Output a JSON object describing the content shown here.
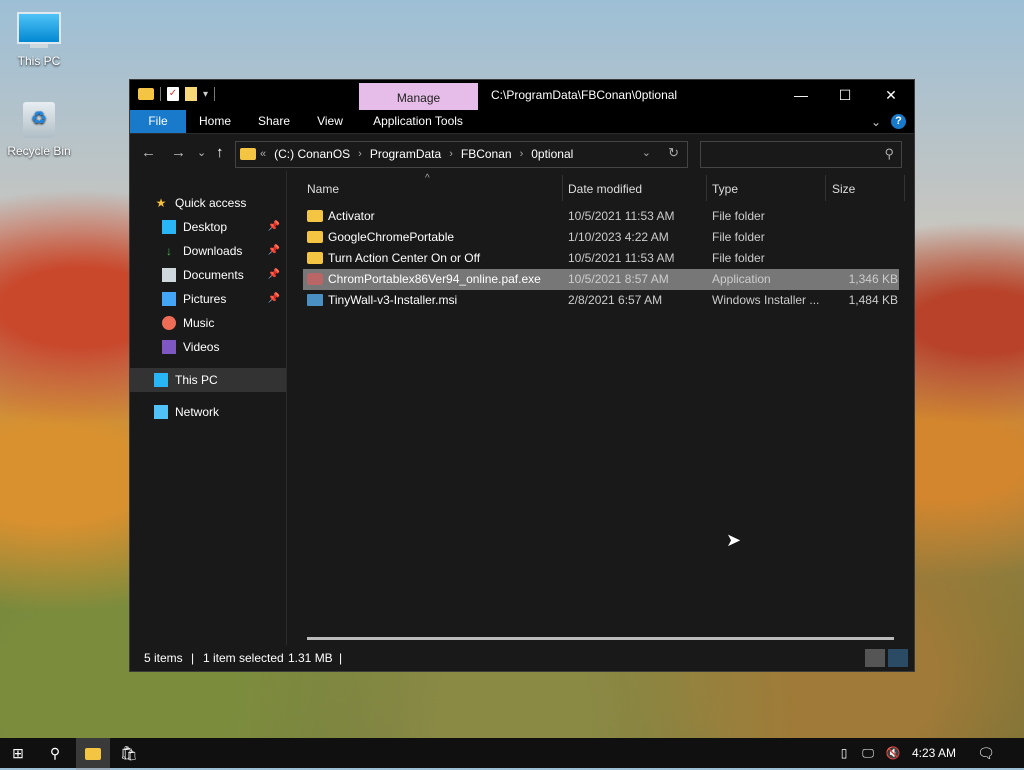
{
  "desktop": {
    "icons": [
      {
        "label": "This PC"
      },
      {
        "label": "Recycle Bin"
      }
    ]
  },
  "window": {
    "manage_tab": "Manage",
    "title": "C:\\ProgramData\\FBConan\\0ptional",
    "ribbon_tabs": [
      "File",
      "Home",
      "Share",
      "View",
      "Application Tools"
    ],
    "address": {
      "overflow": "«",
      "segments": [
        "(C:) ConanOS",
        "ProgramData",
        "FBConan",
        "0ptional"
      ]
    },
    "search": {
      "placeholder": ""
    },
    "nav": {
      "quick_access": "Quick access",
      "items": [
        "Desktop",
        "Downloads",
        "Documents",
        "Pictures",
        "Music",
        "Videos"
      ],
      "this_pc": "This PC",
      "network": "Network"
    },
    "columns": [
      "Name",
      "Date modified",
      "Type",
      "Size"
    ],
    "files": [
      {
        "name": "Activator",
        "date": "10/5/2021 11:53 AM",
        "type": "File folder",
        "size": ""
      },
      {
        "name": "GoogleChromePortable",
        "date": "1/10/2023 4:22 AM",
        "type": "File folder",
        "size": ""
      },
      {
        "name": "Turn Action Center On or Off",
        "date": "10/5/2021 11:53 AM",
        "type": "File folder",
        "size": ""
      },
      {
        "name": "ChromPortablex86Ver94_online.paf.exe",
        "date": "10/5/2021 8:57 AM",
        "type": "Application",
        "size": "1,346 KB"
      },
      {
        "name": "TinyWall-v3-Installer.msi",
        "date": "2/8/2021 6:57 AM",
        "type": "Windows Installer ...",
        "size": "1,484 KB"
      }
    ],
    "status": {
      "count": "5 items",
      "selected": "1 item selected",
      "size": "1.31 MB"
    }
  },
  "taskbar": {
    "clock": "4:23 AM"
  },
  "colors": {
    "accent": "#1979ca",
    "manage_tab": "#e6bde8",
    "folder": "#f4c542",
    "selected_row": "#777777"
  }
}
